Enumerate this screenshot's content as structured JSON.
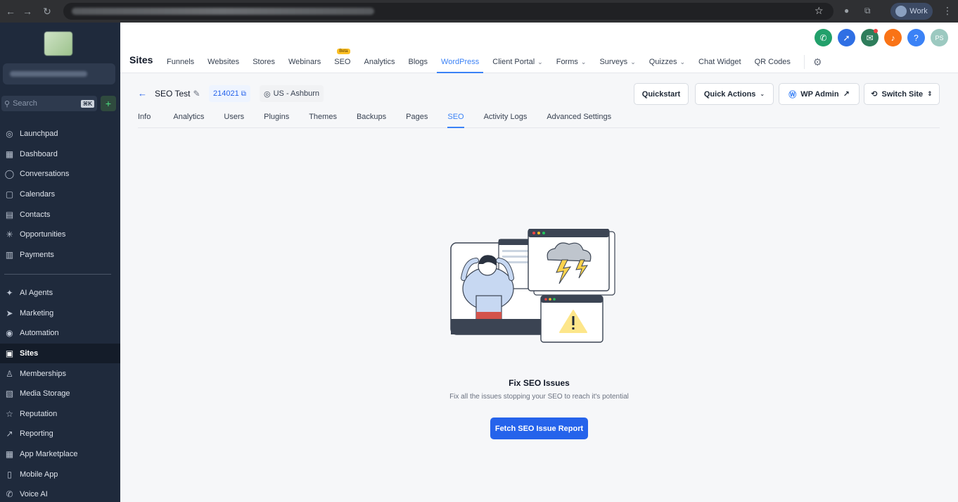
{
  "browser": {
    "profile_label": "Work"
  },
  "sidebar": {
    "search_placeholder": "Search",
    "search_shortcut": "⌘K",
    "add_label": "+",
    "items_top": [
      {
        "label": "Launchpad",
        "icon": "launchpad-icon"
      },
      {
        "label": "Dashboard",
        "icon": "dashboard-icon"
      },
      {
        "label": "Conversations",
        "icon": "chat-icon"
      },
      {
        "label": "Calendars",
        "icon": "calendar-icon"
      },
      {
        "label": "Contacts",
        "icon": "contacts-icon"
      },
      {
        "label": "Opportunities",
        "icon": "opportunities-icon"
      },
      {
        "label": "Payments",
        "icon": "payments-icon"
      }
    ],
    "items_bottom": [
      {
        "label": "AI Agents",
        "icon": "ai-agents-icon"
      },
      {
        "label": "Marketing",
        "icon": "send-icon"
      },
      {
        "label": "Automation",
        "icon": "automation-icon"
      },
      {
        "label": "Sites",
        "icon": "sites-icon",
        "active": true
      },
      {
        "label": "Memberships",
        "icon": "memberships-icon"
      },
      {
        "label": "Media Storage",
        "icon": "media-icon"
      },
      {
        "label": "Reputation",
        "icon": "star-icon"
      },
      {
        "label": "Reporting",
        "icon": "reporting-icon"
      },
      {
        "label": "App Marketplace",
        "icon": "apps-icon"
      },
      {
        "label": "Mobile App",
        "icon": "mobile-icon"
      },
      {
        "label": "Voice AI",
        "icon": "phone-icon"
      }
    ]
  },
  "header": {
    "title": "Sites",
    "avatar_initials": "PS",
    "beta_label": "Beta",
    "tabs": [
      {
        "label": "Funnels"
      },
      {
        "label": "Websites"
      },
      {
        "label": "Stores"
      },
      {
        "label": "Webinars"
      },
      {
        "label": "SEO",
        "beta": true
      },
      {
        "label": "Analytics"
      },
      {
        "label": "Blogs"
      },
      {
        "label": "WordPress",
        "active": true
      },
      {
        "label": "Client Portal",
        "dropdown": true
      },
      {
        "label": "Forms",
        "dropdown": true
      },
      {
        "label": "Surveys",
        "dropdown": true
      },
      {
        "label": "Quizzes",
        "dropdown": true
      },
      {
        "label": "Chat Widget"
      },
      {
        "label": "QR Codes"
      }
    ],
    "icon_colors": {
      "phone": "#22a06b",
      "rocket": "#2f6fe4",
      "megaphone": "#2e7d5b",
      "bell": "#f97316",
      "help": "#3b82f6",
      "avatar": "#9cc9c0"
    }
  },
  "site": {
    "name": "SEO Test",
    "id": "214021",
    "location": "US - Ashburn",
    "buttons": {
      "quickstart": "Quickstart",
      "quick_actions": "Quick Actions",
      "wp_admin": "WP Admin",
      "switch_site": "Switch Site"
    },
    "tabs": [
      {
        "label": "Info"
      },
      {
        "label": "Analytics"
      },
      {
        "label": "Users"
      },
      {
        "label": "Plugins"
      },
      {
        "label": "Themes"
      },
      {
        "label": "Backups"
      },
      {
        "label": "Pages"
      },
      {
        "label": "SEO",
        "active": true
      },
      {
        "label": "Activity Logs"
      },
      {
        "label": "Advanced Settings"
      }
    ]
  },
  "empty_state": {
    "title": "Fix SEO Issues",
    "subtitle": "Fix all the issues stopping your SEO to reach it's potential",
    "button": "Fetch SEO Issue Report"
  },
  "colors": {
    "accent": "#2563eb",
    "sidebar_bg": "#1f2a3c"
  }
}
